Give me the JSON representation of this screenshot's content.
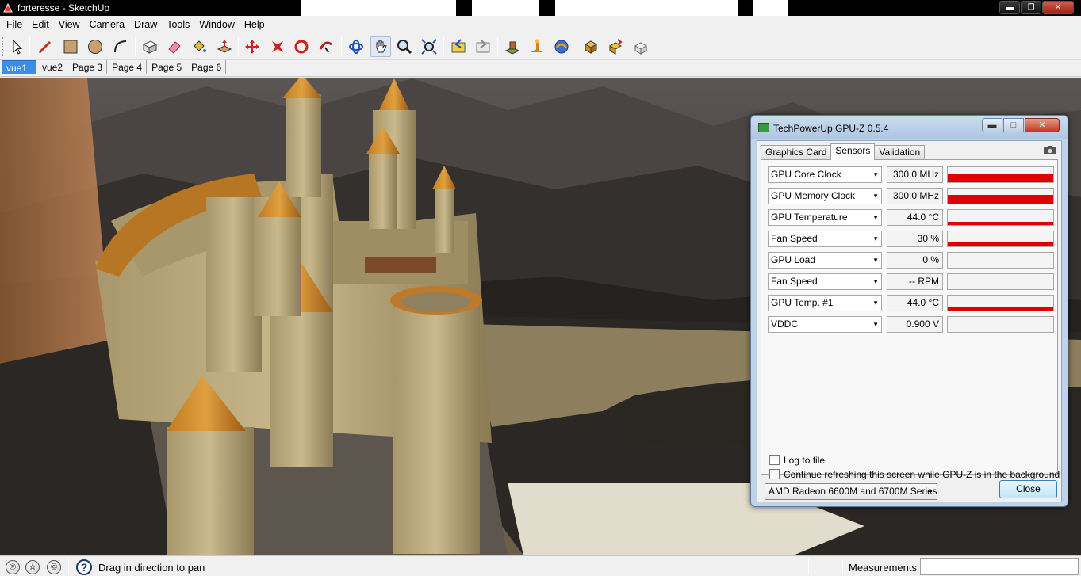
{
  "window": {
    "title": "forteresse - SketchUp"
  },
  "menu": [
    "File",
    "Edit",
    "View",
    "Camera",
    "Draw",
    "Tools",
    "Window",
    "Help"
  ],
  "toolbar": {
    "tools": [
      "select-tool-icon",
      "line-tool-icon",
      "rectangle-tool-icon",
      "circle-tool-icon",
      "arc-tool-icon",
      "make-component-icon",
      "eraser-tool-icon",
      "paint-bucket-icon",
      "push-pull-icon",
      "move-tool-icon",
      "rotate-tool-icon",
      "follow-me-icon",
      "orbit-tool-icon",
      "pan-tool-icon",
      "zoom-tool-icon",
      "zoom-extents-icon",
      "previous-view-icon",
      "next-view-icon",
      "add-location-icon",
      "toggle-terrain-icon",
      "get-models-icon",
      "share-model-icon",
      "get-component-icon",
      "share-component-icon",
      "send-to-layout-icon"
    ]
  },
  "scene_tabs": [
    "vue1",
    "vue2",
    "Page 3",
    "Page 4",
    "Page 5",
    "Page 6"
  ],
  "status": {
    "hint": "Drag in direction to pan",
    "measurements_label": "Measurements",
    "measurements_value": ""
  },
  "gpuz": {
    "title": "TechPowerUp GPU-Z 0.5.4",
    "tabs": [
      "Graphics Card",
      "Sensors",
      "Validation"
    ],
    "active_tab": "Sensors",
    "sensors": [
      {
        "name": "GPU Core Clock",
        "value": "300.0 MHz",
        "level": 0.6
      },
      {
        "name": "GPU Memory Clock",
        "value": "300.0 MHz",
        "level": 0.6
      },
      {
        "name": "GPU Temperature",
        "value": "44.0 °C",
        "level": 0.2
      },
      {
        "name": "Fan Speed",
        "value": "30 %",
        "level": 0.3
      },
      {
        "name": "GPU Load",
        "value": "0 %",
        "level": 0
      },
      {
        "name": "Fan Speed",
        "value": "-- RPM",
        "level": 0
      },
      {
        "name": "GPU Temp. #1",
        "value": "44.0 °C",
        "level": 0.2
      },
      {
        "name": "VDDC",
        "value": "0.900 V",
        "level": 0
      }
    ],
    "log_to_file": "Log to file",
    "continue_refresh": "Continue refreshing this screen while GPU-Z is in the background",
    "gpu_name": "AMD Radeon 6600M and 6700M Series",
    "close_label": "Close",
    "graph_color": "#e00000"
  }
}
